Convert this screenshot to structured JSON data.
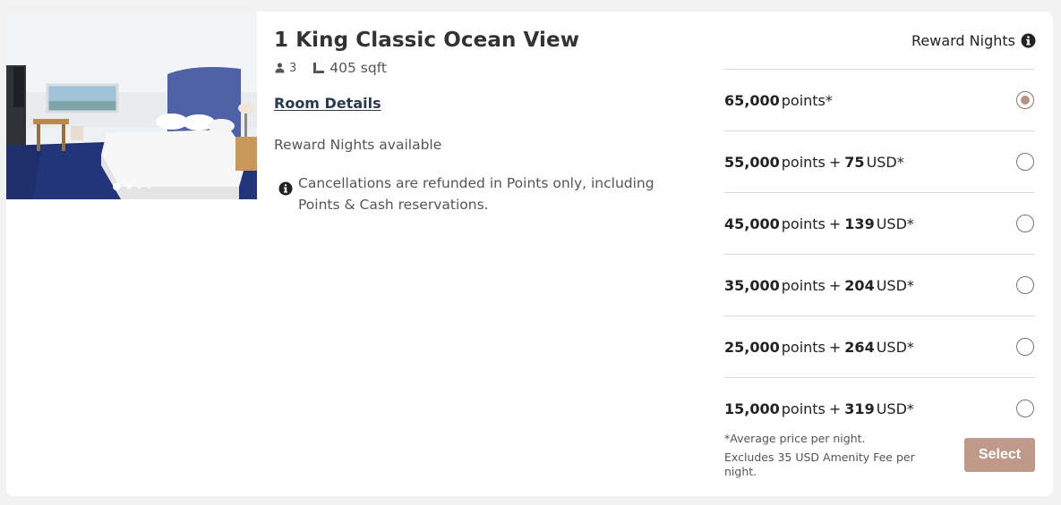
{
  "room": {
    "title": "1 King Classic Ocean View",
    "guests": "3",
    "size": "405 sqft",
    "details_link": "Room Details",
    "availability": "Reward Nights available",
    "cancellation_note": "Cancellations are refunded in Points only, including Points & Cash reservations.",
    "photo_carousel": {
      "slides_visible": 4,
      "active_index": 0
    }
  },
  "rates": {
    "header": "Reward Nights",
    "options": [
      {
        "points": "65,000",
        "points_label": "points*",
        "plus": "",
        "cash": "",
        "currency": "",
        "selected": true
      },
      {
        "points": "55,000",
        "points_label": "points",
        "plus": "+",
        "cash": "75",
        "currency": "USD*",
        "selected": false
      },
      {
        "points": "45,000",
        "points_label": "points",
        "plus": "+",
        "cash": "139",
        "currency": "USD*",
        "selected": false
      },
      {
        "points": "35,000",
        "points_label": "points",
        "plus": "+",
        "cash": "204",
        "currency": "USD*",
        "selected": false
      },
      {
        "points": "25,000",
        "points_label": "points",
        "plus": "+",
        "cash": "264",
        "currency": "USD*",
        "selected": false
      },
      {
        "points": "15,000",
        "points_label": "points",
        "plus": "+",
        "cash": "319",
        "currency": "USD*",
        "selected": false
      }
    ],
    "footnote_average": "*Average price per night.",
    "footnote_fee": "Excludes 35 USD Amenity Fee per night.",
    "select_label": "Select"
  },
  "icons": {
    "guest": "person-icon",
    "size": "floor-plan-icon",
    "info": "info-circle-icon"
  },
  "colors": {
    "accent": "#bf9a8a",
    "radio_selected": "#b39384",
    "link": "#2a3a4d"
  }
}
